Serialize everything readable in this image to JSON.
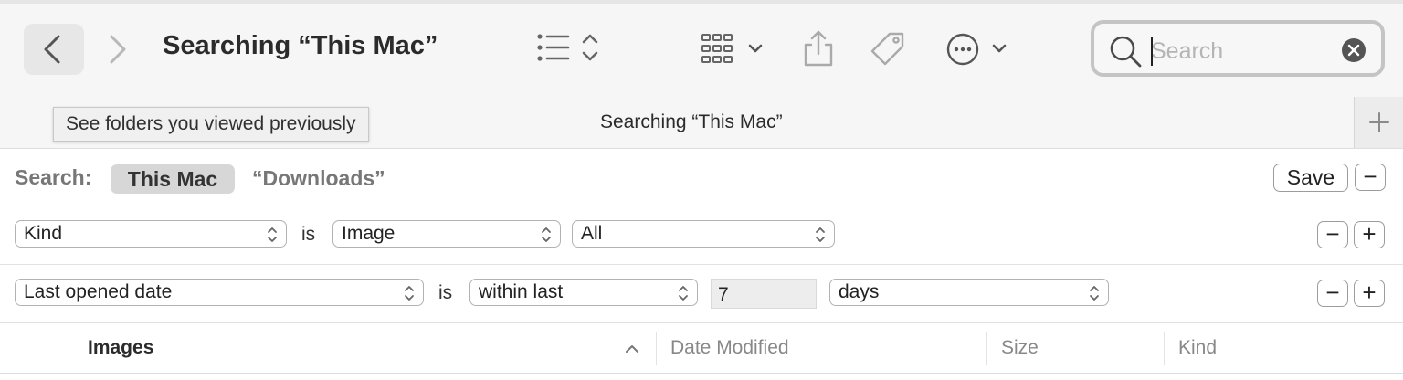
{
  "window": {
    "title": "Searching “This Mac”"
  },
  "toolbar": {
    "back_icon": "chevron-left-icon",
    "forward_icon": "chevron-right-icon",
    "view_list_icon": "list-view-icon",
    "group_icon": "grid-view-icon",
    "share_icon": "share-icon",
    "tag_icon": "tag-icon",
    "more_icon": "ellipsis-circle-icon"
  },
  "search": {
    "placeholder": "Search",
    "icon": "magnifier-icon",
    "clear_icon": "clear-circle-icon"
  },
  "tooltip": {
    "text": "See folders you viewed previously"
  },
  "tabs": [
    {
      "label": "Searching “This Mac”"
    }
  ],
  "new_tab_label": "+",
  "scope_bar": {
    "label": "Search:",
    "selected_scope": "This Mac",
    "other_scope": "“Downloads”",
    "save_label": "Save",
    "remove_label": "−"
  },
  "criteria": [
    {
      "attribute": "Kind",
      "operator": "is",
      "value": "Image",
      "subvalue": "All",
      "remove_label": "−",
      "add_label": "+"
    },
    {
      "attribute": "Last opened date",
      "operator": "is",
      "value": "within last",
      "number": "7",
      "unit": "days",
      "remove_label": "−",
      "add_label": "+"
    }
  ],
  "table": {
    "columns": [
      "Images",
      "Date Modified",
      "Size",
      "Kind"
    ],
    "sort_indicator": "^"
  },
  "colors": {
    "toolbar_bg": "#f6f6f6",
    "pill_bg": "#d7d7d7",
    "border": "#9c9c9c"
  }
}
